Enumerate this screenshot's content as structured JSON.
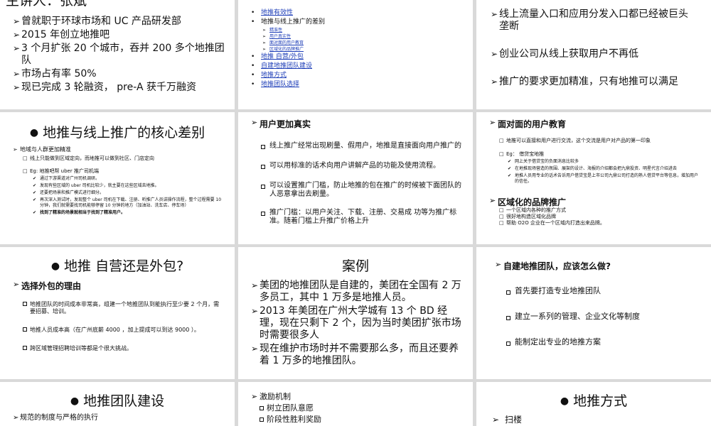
{
  "s1": {
    "title": "主讲人：张斌",
    "items": [
      "曾就职于环球市场和 UC 产品研发部",
      "2015 年创立地推吧",
      "3 个月扩张 20 个城市，吞并 200 多个地推团队",
      "市场占有率 50%",
      "现已完成 3 轮融资， pre-A 获千万融资"
    ]
  },
  "s2": {
    "items": [
      "地推有效性",
      "地推与线上推广的差别"
    ],
    "subitems": [
      "精准性",
      "用户真实性",
      "面对面的用户教育",
      "区域化的品牌推广"
    ],
    "items2": [
      "地推 自营/外包",
      "自建地推团队建设",
      "地推方式",
      "地推团队选择"
    ]
  },
  "s3": {
    "items": [
      "线上流量入口和应用分发入口都已经被巨头垄断",
      "创业公司从线上获取用户不再低",
      "推广的要求更加精准，只有地推可以满足"
    ]
  },
  "s4": {
    "title": "地推与线上推广的核心差别",
    "head": "地域与人群更加精准",
    "l1": "线上只能做到区域定向，而地推可以做到社区、门店定向",
    "l2": "Eg: 地推吧帮 uber 推广司机端",
    "subs": [
      "通过下游渠道对广州司机调研。",
      "发现有些区域的 uber 司机比较少，就主要在这些区域去地推。",
      "还要把场景和推广模式进行细分。",
      "再次深入测试时，发现整个 uber 司机在下载、注册、听推广人员讲操作流程，整个过程需要 10 分钟，我们就需要找司机能够停留 10 分钟的地方（加油站、洗车店、停车场）"
    ],
    "last": "找到了精准的场景就相当于找到了精准用户。"
  },
  "s5": {
    "head": "用户更加真实",
    "items": [
      "线上推广经常出现刷量、假用户，地推是直接面向用户推广的",
      "可以用标准的话术向用户讲解产品的功能及使用流程。",
      "可以设置推广门槛，防止地推的包在推广的时候被下面团队的人恶意拿出去刷量。",
      "推广门槛：以用户关注、下载、注册、交易成 功等为推广标准。随着门槛上升推广价格上升"
    ]
  },
  "s6": {
    "head1": "面对面的用户教育",
    "l1": "地推可以直接和用户进行交流，这个交流是用户对产品的第一印象",
    "eg": "Eg： 借贷宝地推",
    "subs": [
      "网上关于借贷宝的负面消息比较多",
      "在地推现场营造的氛围、展架的设计、海报的介绍都会把九鼎投资、明星代言介绍进去",
      "地推人员用专业的话术告诉用户借贷宝是上市公司九鼎公司打造的熟人借贷平台等信息，增加用户的信任。"
    ],
    "head2": "区域化的品牌推广",
    "items2": [
      "一个区域内各种的推广方式",
      "很好地构造区域化品牌",
      "帮助 O2O 企业在一个区域内打造出来品牌。"
    ]
  },
  "s7": {
    "title": "地推 自营还是外包?",
    "head": "选择外包的理由",
    "items": [
      "地推团队的时间成本非常高，组建一个地推团队到能执行至少要 2 个月，需要招募、培训。",
      "地推人员成本高（在广州底薪 4000 ，加上提成可以到达 9000 ）。",
      "跨区域管理招聘培训等都是个很大挑战。"
    ]
  },
  "s8": {
    "title": "案例",
    "items": [
      "美团的地推团队是自建的，美团在全国有 2 万多员工，其中 1 万多是地推人员。",
      "2013 年美团在广州大学城有 13 个 BD 经理，现在只剩下 2 个，因为当时美团扩张市场时需要很多人",
      "现在维护市场时并不需要那么多，而且还要养着 1 万多的地推团队。"
    ]
  },
  "s9": {
    "head": "自建地推团队，应该怎么做?",
    "items": [
      "首先要打造专业地推团队",
      "建立一系列的管理、企业文化等制度",
      "能制定出专业的地推方案"
    ]
  },
  "s10": {
    "title": "地推团队建设",
    "item": "规范的制度与严格的执行"
  },
  "s11": {
    "head": "激励机制",
    "items": [
      "树立团队意愿",
      "阶段性胜利奖励"
    ]
  },
  "s12": {
    "title": "地推方式",
    "item": "扫楼"
  }
}
